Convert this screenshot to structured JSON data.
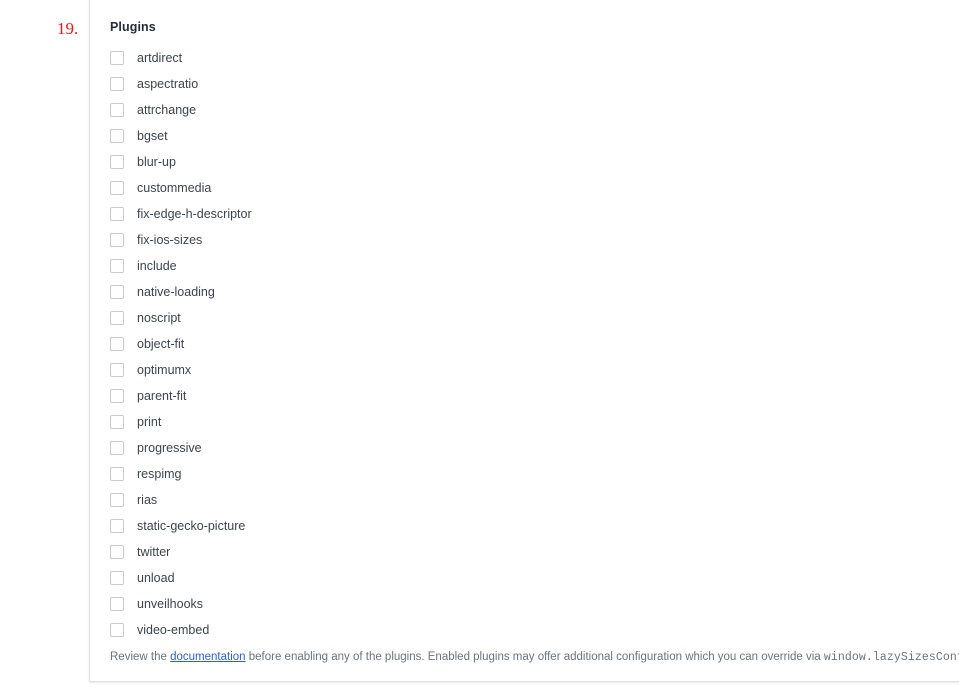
{
  "annotation": {
    "marker_label": "19.",
    "marker_color": "#f01616"
  },
  "panel": {
    "title": "Plugins",
    "plugins": [
      {
        "name": "artdirect",
        "checked": false
      },
      {
        "name": "aspectratio",
        "checked": false
      },
      {
        "name": "attrchange",
        "checked": false
      },
      {
        "name": "bgset",
        "checked": false
      },
      {
        "name": "blur-up",
        "checked": false
      },
      {
        "name": "custommedia",
        "checked": false
      },
      {
        "name": "fix-edge-h-descriptor",
        "checked": false
      },
      {
        "name": "fix-ios-sizes",
        "checked": false
      },
      {
        "name": "include",
        "checked": false
      },
      {
        "name": "native-loading",
        "checked": false
      },
      {
        "name": "noscript",
        "checked": false
      },
      {
        "name": "object-fit",
        "checked": false
      },
      {
        "name": "optimumx",
        "checked": false
      },
      {
        "name": "parent-fit",
        "checked": false
      },
      {
        "name": "print",
        "checked": false
      },
      {
        "name": "progressive",
        "checked": false
      },
      {
        "name": "respimg",
        "checked": false
      },
      {
        "name": "rias",
        "checked": false
      },
      {
        "name": "static-gecko-picture",
        "checked": false
      },
      {
        "name": "twitter",
        "checked": false
      },
      {
        "name": "unload",
        "checked": false
      },
      {
        "name": "unveilhooks",
        "checked": false
      },
      {
        "name": "video-embed",
        "checked": false
      }
    ],
    "footnote": {
      "before_link": "Review the ",
      "link_text": "documentation",
      "after_link": " before enabling any of the plugins. Enabled plugins may offer additional configuration which you can override via ",
      "code": "window.lazySizesConfig"
    }
  },
  "colors": {
    "link": "#2f5fd0",
    "label_text": "#3c4450",
    "title_text": "#232c3d",
    "footnote_text": "#6b7280",
    "checkbox_border": "#c9c9cf",
    "panel_border": "#e3e3ea"
  }
}
